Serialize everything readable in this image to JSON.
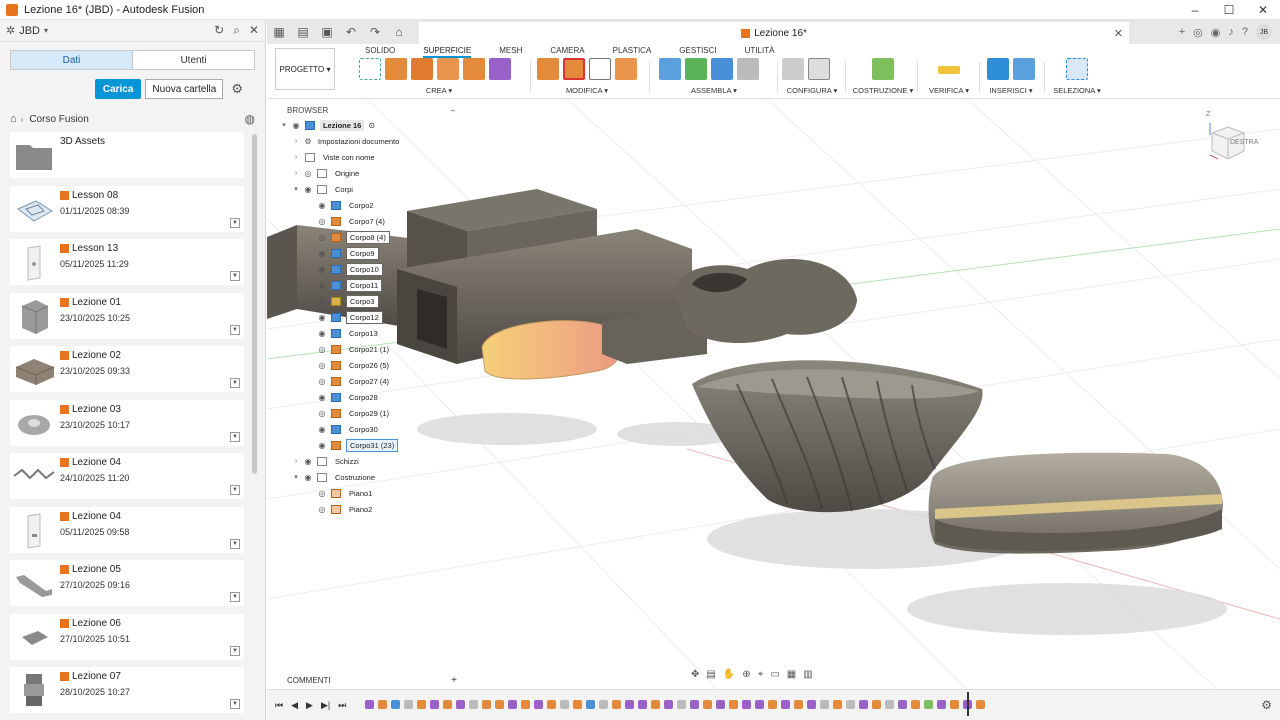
{
  "window": {
    "title": "Lezione 16* (JBD) - Autodesk Fusion"
  },
  "left_panel": {
    "team": "JBD",
    "tabs": [
      "Dati",
      "Utenti"
    ],
    "upload_label": "Carica",
    "new_folder_label": "Nuova cartella",
    "breadcrumb": "Corso Fusion",
    "folder": {
      "name": "3D Assets"
    },
    "files": [
      {
        "name": "Lesson 08",
        "date": "01/11/2025 08:39"
      },
      {
        "name": "Lesson 13",
        "date": "05/11/2025 11:29"
      },
      {
        "name": "Lezione 01",
        "date": "23/10/2025 10:25"
      },
      {
        "name": "Lezione 02",
        "date": "23/10/2025 09:33"
      },
      {
        "name": "Lezione 03",
        "date": "23/10/2025 10:17"
      },
      {
        "name": "Lezione 04",
        "date": "24/10/2025 11:20"
      },
      {
        "name": "Lezione 04",
        "date": "05/11/2025 09:58"
      },
      {
        "name": "Lezione 05",
        "date": "27/10/2025 09:16"
      },
      {
        "name": "Lezione 06",
        "date": "27/10/2025 10:51"
      },
      {
        "name": "Lezione 07",
        "date": "28/10/2025 10:27"
      }
    ]
  },
  "document": {
    "tab_title": "Lezione 16*",
    "avatar": "JB"
  },
  "ribbon": {
    "workspace": "PROGETTO",
    "tabs": [
      "SOLIDO",
      "SUPERFICIE",
      "MESH",
      "CAMERA",
      "PLASTICA",
      "GESTISCI",
      "UTILITÀ"
    ],
    "active_tab": "SUPERFICIE",
    "groups": [
      "CREA",
      "MODIFICA",
      "ASSEMBLA",
      "CONFIGURA",
      "COSTRUZIONE",
      "VERIFICA",
      "INSERISCI",
      "SELEZIONA"
    ]
  },
  "browser": {
    "title": "BROWSER",
    "root": "Lezione 16",
    "items": [
      {
        "label": "Impostazioni documento"
      },
      {
        "label": "Viste con nome"
      },
      {
        "label": "Origine"
      },
      {
        "label": "Corpi"
      },
      {
        "label": "Corpo2"
      },
      {
        "label": "Corpo7 (4)"
      },
      {
        "label": "Corpo8 (4)"
      },
      {
        "label": "Corpo9"
      },
      {
        "label": "Corpo10"
      },
      {
        "label": "Corpo11"
      },
      {
        "label": "Corpo3"
      },
      {
        "label": "Corpo12"
      },
      {
        "label": "Corpo13"
      },
      {
        "label": "Corpo21 (1)"
      },
      {
        "label": "Corpo26 (5)"
      },
      {
        "label": "Corpo27 (4)"
      },
      {
        "label": "Corpo28"
      },
      {
        "label": "Corpo29 (1)"
      },
      {
        "label": "Corpo30"
      },
      {
        "label": "Corpo31 (23)"
      },
      {
        "label": "Schizzi"
      },
      {
        "label": "Costruzione"
      },
      {
        "label": "Piano1"
      },
      {
        "label": "Piano2"
      }
    ]
  },
  "viewcube": {
    "face": "DESTRA",
    "axis": "Z"
  },
  "comments": {
    "label": "COMMENTI"
  },
  "colors": {
    "accent": "#0696d7",
    "fusion_orange": "#e8731d"
  }
}
